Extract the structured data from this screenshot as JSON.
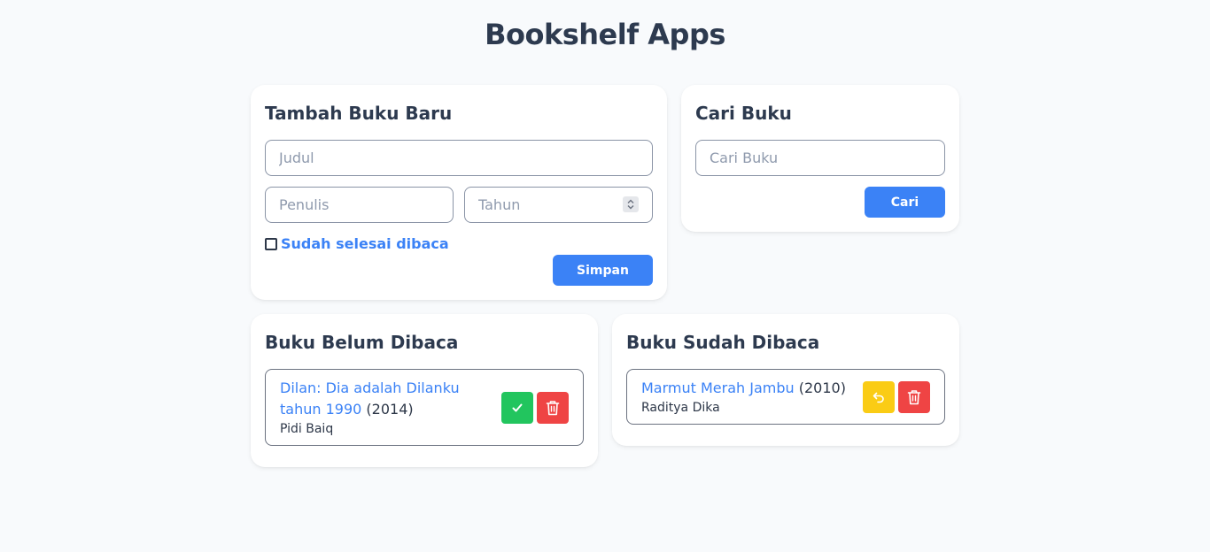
{
  "app": {
    "title": "Bookshelf Apps"
  },
  "add_book": {
    "title": "Tambah Buku Baru",
    "judul_placeholder": "Judul",
    "penulis_placeholder": "Penulis",
    "tahun_placeholder": "Tahun",
    "checkbox_label": "Sudah selesai dibaca",
    "submit_label": "Simpan"
  },
  "search": {
    "title": "Cari Buku",
    "placeholder": "Cari Buku",
    "button_label": "Cari"
  },
  "unread": {
    "title": "Buku Belum Dibaca",
    "books": [
      {
        "title": "Dilan: Dia adalah Dilanku tahun 1990",
        "year": "(2014)",
        "author": "Pidi Baiq"
      }
    ]
  },
  "read": {
    "title": "Buku Sudah Dibaca",
    "books": [
      {
        "title": "Marmut Merah Jambu",
        "year": "(2010)",
        "author": "Raditya Dika"
      }
    ]
  },
  "colors": {
    "primary": "#3b82f6",
    "success": "#22c55e",
    "danger": "#ef4444",
    "warning": "#facc15"
  },
  "icons": {
    "complete": "check-icon",
    "delete": "trash-icon",
    "undo": "undo-icon"
  }
}
